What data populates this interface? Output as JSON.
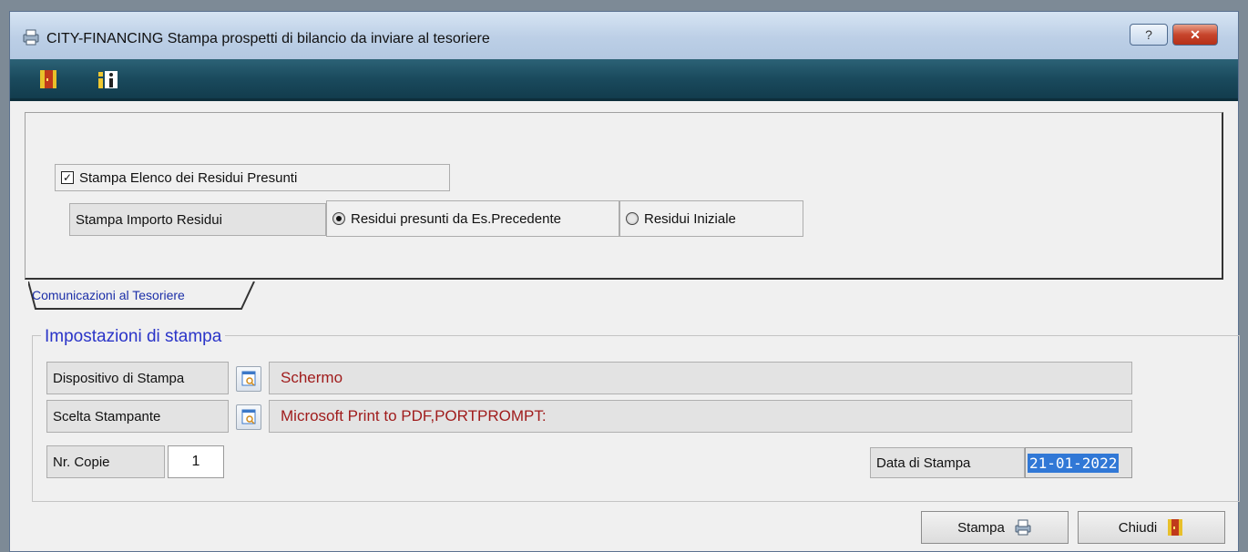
{
  "window": {
    "title": "CITY-FINANCING  Stampa prospetti di bilancio da inviare al tesoriere",
    "help_label": "?",
    "close_label": "✕"
  },
  "toolbar": {
    "items": [
      {
        "name": "exit-door-icon"
      },
      {
        "name": "info-icon"
      }
    ]
  },
  "options": {
    "checkbox_label": "Stampa Elenco dei Residui Presunti",
    "checkbox_checked": true,
    "import_label": "Stampa Importo Residui",
    "radio1_label": "Residui presunti da Es.Precedente",
    "radio2_label": "Residui Iniziale",
    "selected_radio": "radio1"
  },
  "tab": {
    "label": "Comunicazioni al Tesoriere"
  },
  "print_settings": {
    "title": "Impostazioni di stampa",
    "device_label": "Dispositivo di Stampa",
    "device_value": "Schermo",
    "printer_label": "Scelta Stampante",
    "printer_value": "Microsoft Print to PDF,PORTPROMPT:",
    "copies_label": "Nr. Copie",
    "copies_value": "1",
    "date_label": "Data di Stampa",
    "date_value": "21-01-2022"
  },
  "buttons": {
    "print_label": "Stampa",
    "close_label": "Chiudi"
  },
  "colors": {
    "value_text": "#a01c1c",
    "group_title": "#2a34c8",
    "toolbar_bg": "#1a4a5d",
    "selection": "#3178d6"
  }
}
